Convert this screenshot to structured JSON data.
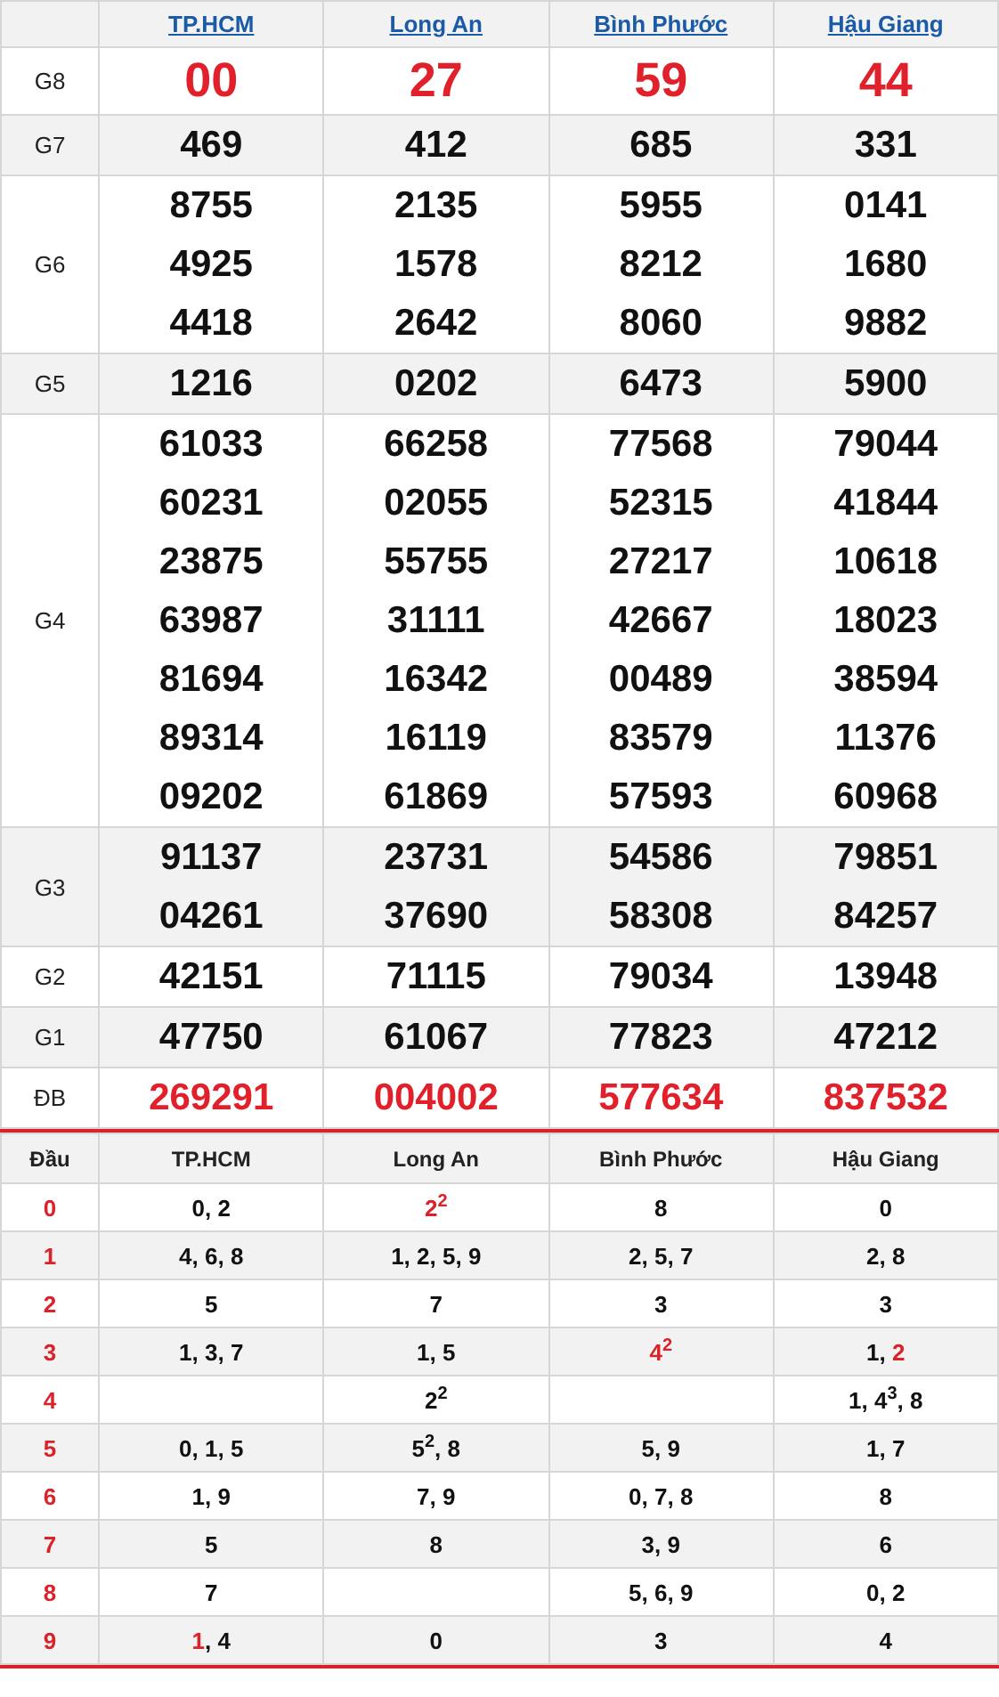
{
  "results": {
    "columns": [
      "TP.HCM",
      "Long An",
      "Bình Phước",
      "Hậu Giang"
    ],
    "rows": [
      {
        "prize": "G8",
        "kind": "highlight",
        "values": [
          [
            "00"
          ],
          [
            "27"
          ],
          [
            "59"
          ],
          [
            "44"
          ]
        ]
      },
      {
        "prize": "G7",
        "kind": "normal",
        "values": [
          [
            "469"
          ],
          [
            "412"
          ],
          [
            "685"
          ],
          [
            "331"
          ]
        ]
      },
      {
        "prize": "G6",
        "kind": "normal",
        "values": [
          [
            "8755",
            "4925",
            "4418"
          ],
          [
            "2135",
            "1578",
            "2642"
          ],
          [
            "5955",
            "8212",
            "8060"
          ],
          [
            "0141",
            "1680",
            "9882"
          ]
        ]
      },
      {
        "prize": "G5",
        "kind": "normal",
        "values": [
          [
            "1216"
          ],
          [
            "0202"
          ],
          [
            "6473"
          ],
          [
            "5900"
          ]
        ]
      },
      {
        "prize": "G4",
        "kind": "normal",
        "values": [
          [
            "61033",
            "60231",
            "23875",
            "63987",
            "81694",
            "89314",
            "09202"
          ],
          [
            "66258",
            "02055",
            "55755",
            "31111",
            "16342",
            "16119",
            "61869"
          ],
          [
            "77568",
            "52315",
            "27217",
            "42667",
            "00489",
            "83579",
            "57593"
          ],
          [
            "79044",
            "41844",
            "10618",
            "18023",
            "38594",
            "11376",
            "60968"
          ]
        ]
      },
      {
        "prize": "G3",
        "kind": "normal",
        "values": [
          [
            "91137",
            "04261"
          ],
          [
            "23731",
            "37690"
          ],
          [
            "54586",
            "58308"
          ],
          [
            "79851",
            "84257"
          ]
        ]
      },
      {
        "prize": "G2",
        "kind": "normal",
        "values": [
          [
            "42151"
          ],
          [
            "71115"
          ],
          [
            "79034"
          ],
          [
            "13948"
          ]
        ]
      },
      {
        "prize": "G1",
        "kind": "normal",
        "values": [
          [
            "47750"
          ],
          [
            "61067"
          ],
          [
            "77823"
          ],
          [
            "47212"
          ]
        ]
      },
      {
        "prize": "ĐB",
        "kind": "special",
        "values": [
          [
            "269291"
          ],
          [
            "004002"
          ],
          [
            "577634"
          ],
          [
            "837532"
          ]
        ]
      }
    ]
  },
  "loto": {
    "head_column": "Đầu",
    "columns": [
      "TP.HCM",
      "Long An",
      "Bình Phước",
      "Hậu Giang"
    ],
    "rows": [
      {
        "head": "0",
        "cells": [
          [
            {
              "text": "0, 2",
              "special": false
            }
          ],
          [
            {
              "text": "2$^{2}$",
              "special": true
            }
          ],
          [
            {
              "text": "8",
              "special": false
            }
          ],
          [
            {
              "text": "0",
              "special": false
            }
          ]
        ]
      },
      {
        "head": "1",
        "cells": [
          [
            {
              "text": "4, 6, 8",
              "special": false
            }
          ],
          [
            {
              "text": "1, 2, 5, 9",
              "special": false
            }
          ],
          [
            {
              "text": "2, 5, 7",
              "special": false
            }
          ],
          [
            {
              "text": "2, 8",
              "special": false
            }
          ]
        ]
      },
      {
        "head": "2",
        "cells": [
          [
            {
              "text": "5",
              "special": false
            }
          ],
          [
            {
              "text": "7",
              "special": false
            }
          ],
          [
            {
              "text": "3",
              "special": false
            }
          ],
          [
            {
              "text": "3",
              "special": false
            }
          ]
        ]
      },
      {
        "head": "3",
        "cells": [
          [
            {
              "text": "1, 3, 7",
              "special": false
            }
          ],
          [
            {
              "text": "1, 5",
              "special": false
            }
          ],
          [
            {
              "text": "4$^{2}$",
              "special": true
            }
          ],
          [
            {
              "text": "1, ",
              "special": false
            },
            {
              "text": "2",
              "special": true
            }
          ]
        ]
      },
      {
        "head": "4",
        "cells": [
          [],
          [
            {
              "text": "2$^{2}$",
              "special": false
            }
          ],
          [],
          [
            {
              "text": "1, 4$^{3}$, 8",
              "special": false
            }
          ]
        ]
      },
      {
        "head": "5",
        "cells": [
          [
            {
              "text": "0, 1, 5",
              "special": false
            }
          ],
          [
            {
              "text": "5$^{2}$, 8",
              "special": false
            }
          ],
          [
            {
              "text": "5, 9",
              "special": false
            }
          ],
          [
            {
              "text": "1, 7",
              "special": false
            }
          ]
        ]
      },
      {
        "head": "6",
        "cells": [
          [
            {
              "text": "1, 9",
              "special": false
            }
          ],
          [
            {
              "text": "7, 9",
              "special": false
            }
          ],
          [
            {
              "text": "0, 7, 8",
              "special": false
            }
          ],
          [
            {
              "text": "8",
              "special": false
            }
          ]
        ]
      },
      {
        "head": "7",
        "cells": [
          [
            {
              "text": "5",
              "special": false
            }
          ],
          [
            {
              "text": "8",
              "special": false
            }
          ],
          [
            {
              "text": "3, 9",
              "special": false
            }
          ],
          [
            {
              "text": "6",
              "special": false
            }
          ]
        ]
      },
      {
        "head": "8",
        "cells": [
          [
            {
              "text": "7",
              "special": false
            }
          ],
          [],
          [
            {
              "text": "5, 6, 9",
              "special": false
            }
          ],
          [
            {
              "text": "0, 2",
              "special": false
            }
          ]
        ]
      },
      {
        "head": "9",
        "cells": [
          [
            {
              "text": "1",
              "special": true
            },
            {
              "text": ", 4",
              "special": false
            }
          ],
          [
            {
              "text": "0",
              "special": false
            }
          ],
          [
            {
              "text": "3",
              "special": false
            }
          ],
          [
            {
              "text": "4",
              "special": false
            }
          ]
        ]
      }
    ]
  }
}
